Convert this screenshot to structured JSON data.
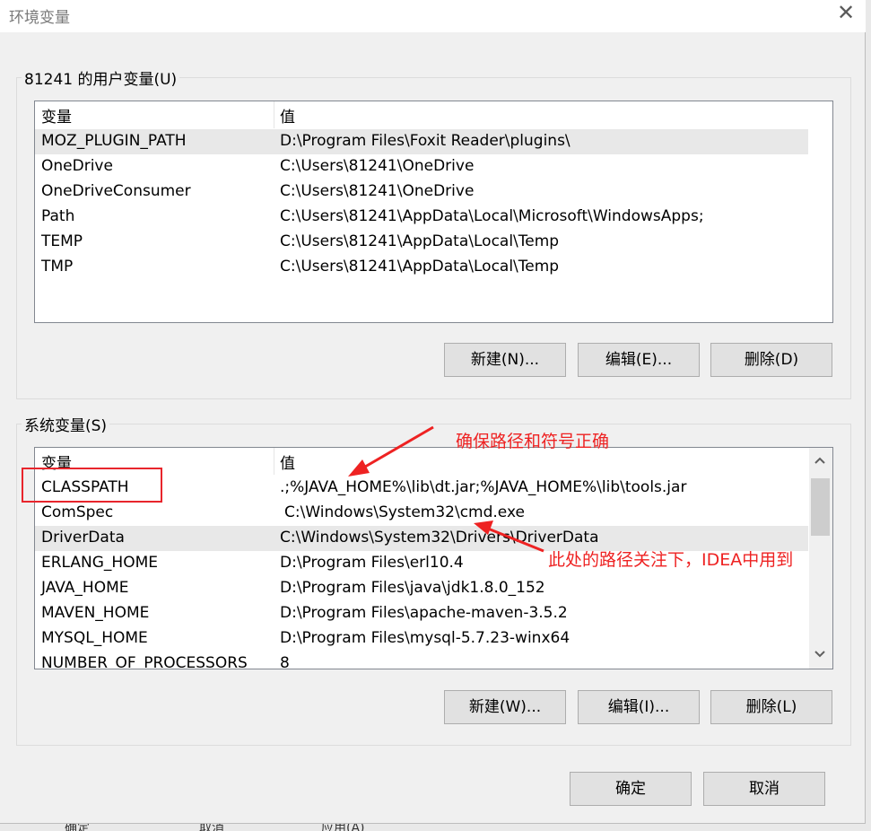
{
  "window": {
    "title": "环境变量",
    "close_glyph": "✕"
  },
  "user_vars": {
    "group_label": "81241 的用户变量(U)",
    "columns": [
      "变量",
      "值"
    ],
    "rows": [
      {
        "name": "MOZ_PLUGIN_PATH",
        "value": "D:\\Program Files\\Foxit Reader\\plugins\\"
      },
      {
        "name": "OneDrive",
        "value": "C:\\Users\\81241\\OneDrive"
      },
      {
        "name": "OneDriveConsumer",
        "value": "C:\\Users\\81241\\OneDrive"
      },
      {
        "name": "Path",
        "value": "C:\\Users\\81241\\AppData\\Local\\Microsoft\\WindowsApps;"
      },
      {
        "name": "TEMP",
        "value": "C:\\Users\\81241\\AppData\\Local\\Temp"
      },
      {
        "name": "TMP",
        "value": "C:\\Users\\81241\\AppData\\Local\\Temp"
      }
    ],
    "buttons": {
      "new": "新建(N)...",
      "edit": "编辑(E)...",
      "delete": "删除(D)"
    }
  },
  "system_vars": {
    "group_label": "系统变量(S)",
    "columns": [
      "变量",
      "值"
    ],
    "rows": [
      {
        "name": "CLASSPATH",
        "value": ".;%JAVA_HOME%\\lib\\dt.jar;%JAVA_HOME%\\lib\\tools.jar"
      },
      {
        "name": "ComSpec",
        "value": "C:\\Windows\\System32\\cmd.exe"
      },
      {
        "name": "DriverData",
        "value": "C:\\Windows\\System32\\Drivers\\DriverData"
      },
      {
        "name": "ERLANG_HOME",
        "value": "D:\\Program Files\\erl10.4"
      },
      {
        "name": "JAVA_HOME",
        "value": "D:\\Program Files\\java\\jdk1.8.0_152"
      },
      {
        "name": "MAVEN_HOME",
        "value": "D:\\Program Files\\apache-maven-3.5.2"
      },
      {
        "name": "MYSQL_HOME",
        "value": "D:\\Program Files\\mysql-5.7.23-winx64"
      },
      {
        "name": "NUMBER_OF_PROCESSORS",
        "value": "8"
      }
    ],
    "buttons": {
      "new": "新建(W)...",
      "edit": "编辑(I)...",
      "delete": "删除(L)"
    },
    "scroll_up_icon": "chevron-up-icon",
    "scroll_down_icon": "chevron-down-icon"
  },
  "dialog_buttons": {
    "ok": "确定",
    "cancel": "取消"
  },
  "annotations": {
    "note_classpath": "确保路径和符号正确",
    "note_javahome": "此处的路径关注下，IDEA中用到",
    "color": "#ee2222"
  },
  "background_window": {
    "buttons": [
      "确定",
      "取消",
      "应用(A)"
    ]
  }
}
